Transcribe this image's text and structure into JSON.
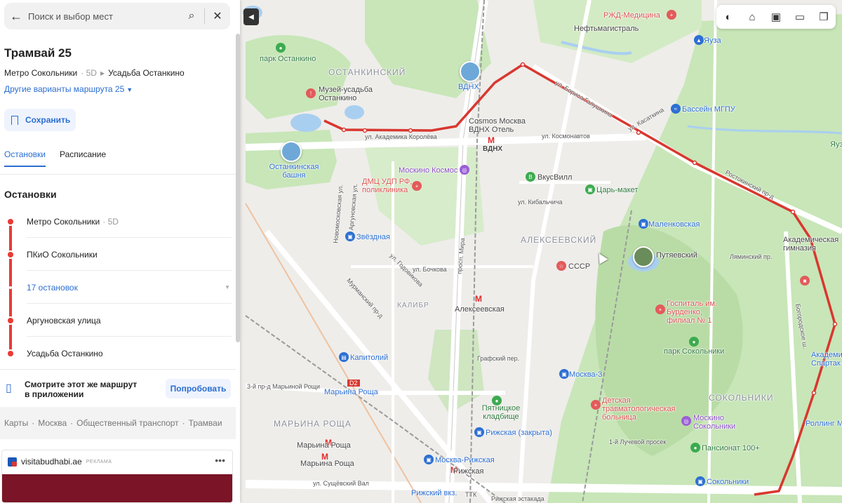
{
  "search": {
    "placeholder": "Поиск и выбор мест"
  },
  "route": {
    "title": "Трамвай 25",
    "from": "Метро Сокольники",
    "from_exit": "· 5D",
    "to": "Усадьба Останкино",
    "variants_link": "Другие варианты маршрута 25"
  },
  "actions": {
    "save_label": "Сохранить"
  },
  "tabs": [
    {
      "label": "Остановки",
      "active": true
    },
    {
      "label": "Расписание",
      "active": false
    }
  ],
  "stops_title": "Остановки",
  "stops": [
    {
      "name": "Метро Сокольники",
      "suffix": "· 5D"
    },
    {
      "name": "ПКиО Сокольники",
      "suffix": ""
    },
    {
      "name": "17 остановок",
      "suffix": ""
    },
    {
      "name": "Аргуновская улица",
      "suffix": ""
    },
    {
      "name": "Усадьба Останкино",
      "suffix": ""
    }
  ],
  "app_promo": {
    "text": "Смотрите этот же маршрут в приложении",
    "button": "Попробовать"
  },
  "breadcrumbs": [
    "Карты",
    "Москва",
    "Общественный транспорт",
    "Трамваи"
  ],
  "ad": {
    "domain": "visitabudhabi.ae",
    "tag": "РЕКЛАМА",
    "banner_color": "#7a1426"
  },
  "colors": {
    "accent": "#2b6ed1",
    "route": "#e83b34",
    "park": "#c8e6b8",
    "water": "#a9cff0"
  },
  "map": {
    "districts": [
      "ОСТАНКИНСКИЙ",
      "АЛЕКСЕЕВСКИЙ",
      "МАРЬИНА РОЩА",
      "СОКОЛЬНИКИ",
      "КАЛИБР"
    ],
    "labels": {
      "ostankino_park": "парк Останкино",
      "museum": "Музей-усадьба Останкино",
      "vdnh": "ВДНХ",
      "vdnh_metro": "ВДНХ",
      "cosmos": "Cosmos Москва ВДНХ Отель",
      "tower": "Останкинская башня",
      "rzd": "РЖД-Медицина",
      "neft": "Нефтьмагистраль",
      "yauza1": "Яуза",
      "yauza2": "Яуза",
      "basein": "Бассейн МГПУ",
      "mosk_cosmos": "Москино Космос",
      "dmc": "ДМЦ УДП РФ, поликлиника",
      "vkusvill": "ВкусВилл",
      "tsar": "Царь-макет",
      "zvezd": "Звёздная",
      "malenk": "Маленковская",
      "putyaev": "Путяевский",
      "sssr": "СССР",
      "alekseev_metro": "Алексеевская",
      "gosp": "Госпиталь им. Бурденко, филиал № 1",
      "park_sok": "парк Сокольники",
      "kapitoliy": "Капитолий",
      "akad_gimn": "Академическая гимназия",
      "akad_spartak": "Академия Спартак",
      "d2": "D2",
      "marina_roscha": "Марьина Роща",
      "moskva3": "Москва-3",
      "pyatnitsk": "Пятницкое кладбище",
      "det_bol": "Детская травматологическая больница",
      "moskino_sok": "Москино Сокольники",
      "rolling": "Роллинг М",
      "rizh_zakr": "Рижская (закрыта)",
      "mr_metro1": "Марьина Роща",
      "mr_metro2": "Марьина Роща",
      "mosk_rizh": "Москва-Рижская",
      "rizh": "Рижская",
      "rizh_vkz": "Рижский вкз.",
      "pansionat": "Пансионат 100+",
      "sokolniki_m": "Сокольники",
      "ak_korol": "ул. Академика Королёва",
      "kosmonavt": "ул. Космонавтов",
      "rostok": "Ростокинский пр-д",
      "galush": "ул. Бориса Галушкина",
      "mira": "просп. Мира",
      "murman": "Мурманский пр-д",
      "sushch": "ул. Сущёвский Вал",
      "rizh_estak": "Рижская эстакада",
      "argun": "Аргуновская ул.",
      "novomosk": "Новомосковская ул.",
      "bochkova": "ул. Бочкова",
      "godovik": "ул. Годовикова",
      "graf": "Графский пер.",
      "kibalch": "ул. Кибальчича",
      "kasatkina": "ул. Касаткина",
      "yaminsk": "Ляминский пр.",
      "bogorod": "Богородское ш.",
      "pervy_luch": "1-й Лучевой просек",
      "ttk": "ТТК",
      "marina_roscha_pr": "3-й пр-д Марьиной Рощи"
    }
  }
}
